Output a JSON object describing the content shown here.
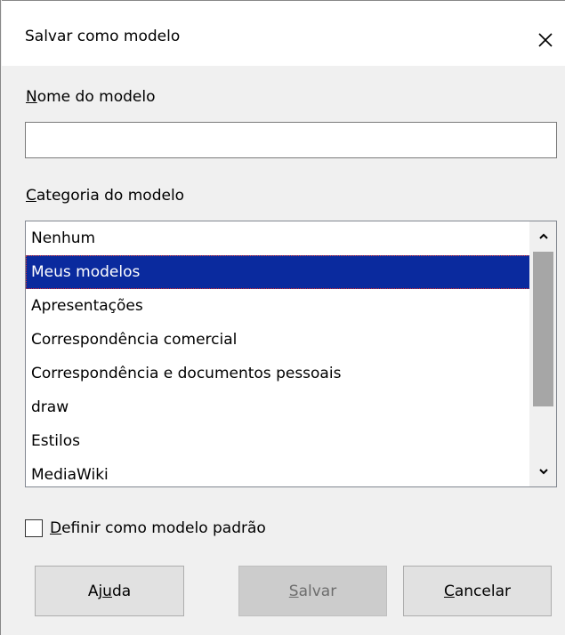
{
  "window": {
    "title": "Salvar como modelo",
    "close_icon": "close-icon"
  },
  "name_field": {
    "label_mnemonic": "N",
    "label_rest": "ome do modelo",
    "value": "",
    "placeholder": ""
  },
  "category": {
    "label_mnemonic": "C",
    "label_rest": "ategoria do modelo",
    "items": [
      {
        "label": "Nenhum",
        "selected": false
      },
      {
        "label": "Meus modelos",
        "selected": true
      },
      {
        "label": "Apresentações",
        "selected": false
      },
      {
        "label": "Correspondência comercial",
        "selected": false
      },
      {
        "label": "Correspondência e documentos pessoais",
        "selected": false
      },
      {
        "label": "draw",
        "selected": false
      },
      {
        "label": "Estilos",
        "selected": false
      },
      {
        "label": "MediaWiki",
        "selected": false
      }
    ]
  },
  "default_checkbox": {
    "checked": false,
    "label_mnemonic": "D",
    "label_rest": "efinir como modelo padrão"
  },
  "buttons": {
    "help": {
      "pre": "Aj",
      "mnemonic": "u",
      "post": "da"
    },
    "save": {
      "pre": "",
      "mnemonic": "S",
      "post": "alvar",
      "enabled": false
    },
    "cancel": {
      "pre": "",
      "mnemonic": "C",
      "post": "ancelar"
    }
  },
  "colors": {
    "selection_bg": "#0a2a9e",
    "selection_text": "#ffffff",
    "dialog_bg": "#f0f0f0"
  }
}
